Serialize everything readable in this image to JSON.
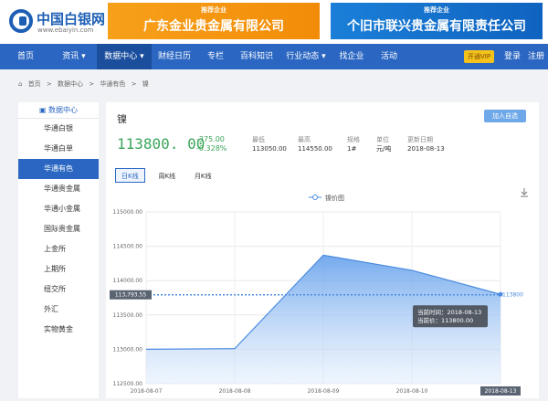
{
  "header": {
    "logo_cn": "中国白银网",
    "logo_en": "www.ebaiyin.com",
    "ad1_tag": "推荐企业",
    "ad1_name": "广东金业贵金属有限公司",
    "ad2_tag": "推荐企业",
    "ad2_name": "个旧市联兴贵金属有限责任公司"
  },
  "nav": {
    "items": [
      "首页",
      "资讯 ▾",
      "数据中心 ▾",
      "财经日历",
      "专栏",
      "百科知识",
      "行业动态 ▾",
      "找企业",
      "活动"
    ],
    "vip": "开通VIP",
    "login": "登录",
    "register": "注册"
  },
  "breadcrumb": [
    "首页",
    ">",
    "数据中心",
    ">",
    "华通有色",
    ">",
    "镍"
  ],
  "sidebar": {
    "head": "数据中心",
    "items": [
      "华通白银",
      "华通白单",
      "华通有色",
      "华通贵金属",
      "华通小金属",
      "国际贵金属",
      "上金所",
      "上期所",
      "纽交所",
      "外汇",
      "实物黄金"
    ]
  },
  "main": {
    "title": "镍",
    "add_btn": "加入自选",
    "price": "113800. 00",
    "change_abs": "-375.00",
    "change_pct": "-0.328%",
    "stats": [
      {
        "label": "最低",
        "value": "113050.00"
      },
      {
        "label": "最高",
        "value": "114550.00"
      },
      {
        "label": "规格",
        "value": "1#"
      },
      {
        "label": "单位",
        "value": "元/吨"
      },
      {
        "label": "更新日期",
        "value": "2018-08-13"
      }
    ],
    "tabs": [
      "日K线",
      "周K线",
      "月K线"
    ]
  },
  "chart_data": {
    "type": "area",
    "legend": "镍价图",
    "x": [
      "2018-08-07",
      "2018-08-08",
      "2018-08-09",
      "2018-08-10",
      "2018-08-13"
    ],
    "values": [
      113000,
      113010,
      114370,
      114150,
      113800
    ],
    "ylim": [
      112500,
      115000
    ],
    "yticks": [
      "115000.00",
      "114500.00",
      "114000.00",
      "113500.00",
      "113000.00",
      "112500.00"
    ],
    "reference_label": "113,793.55",
    "reference_right": "113800",
    "tooltip_time": "当前时间：2018-08-13",
    "tooltip_price": "当前价：113800.00",
    "x_highlight": "2018-08-13",
    "area_color": "#5b9bea",
    "line_color": "#4a8be0"
  }
}
